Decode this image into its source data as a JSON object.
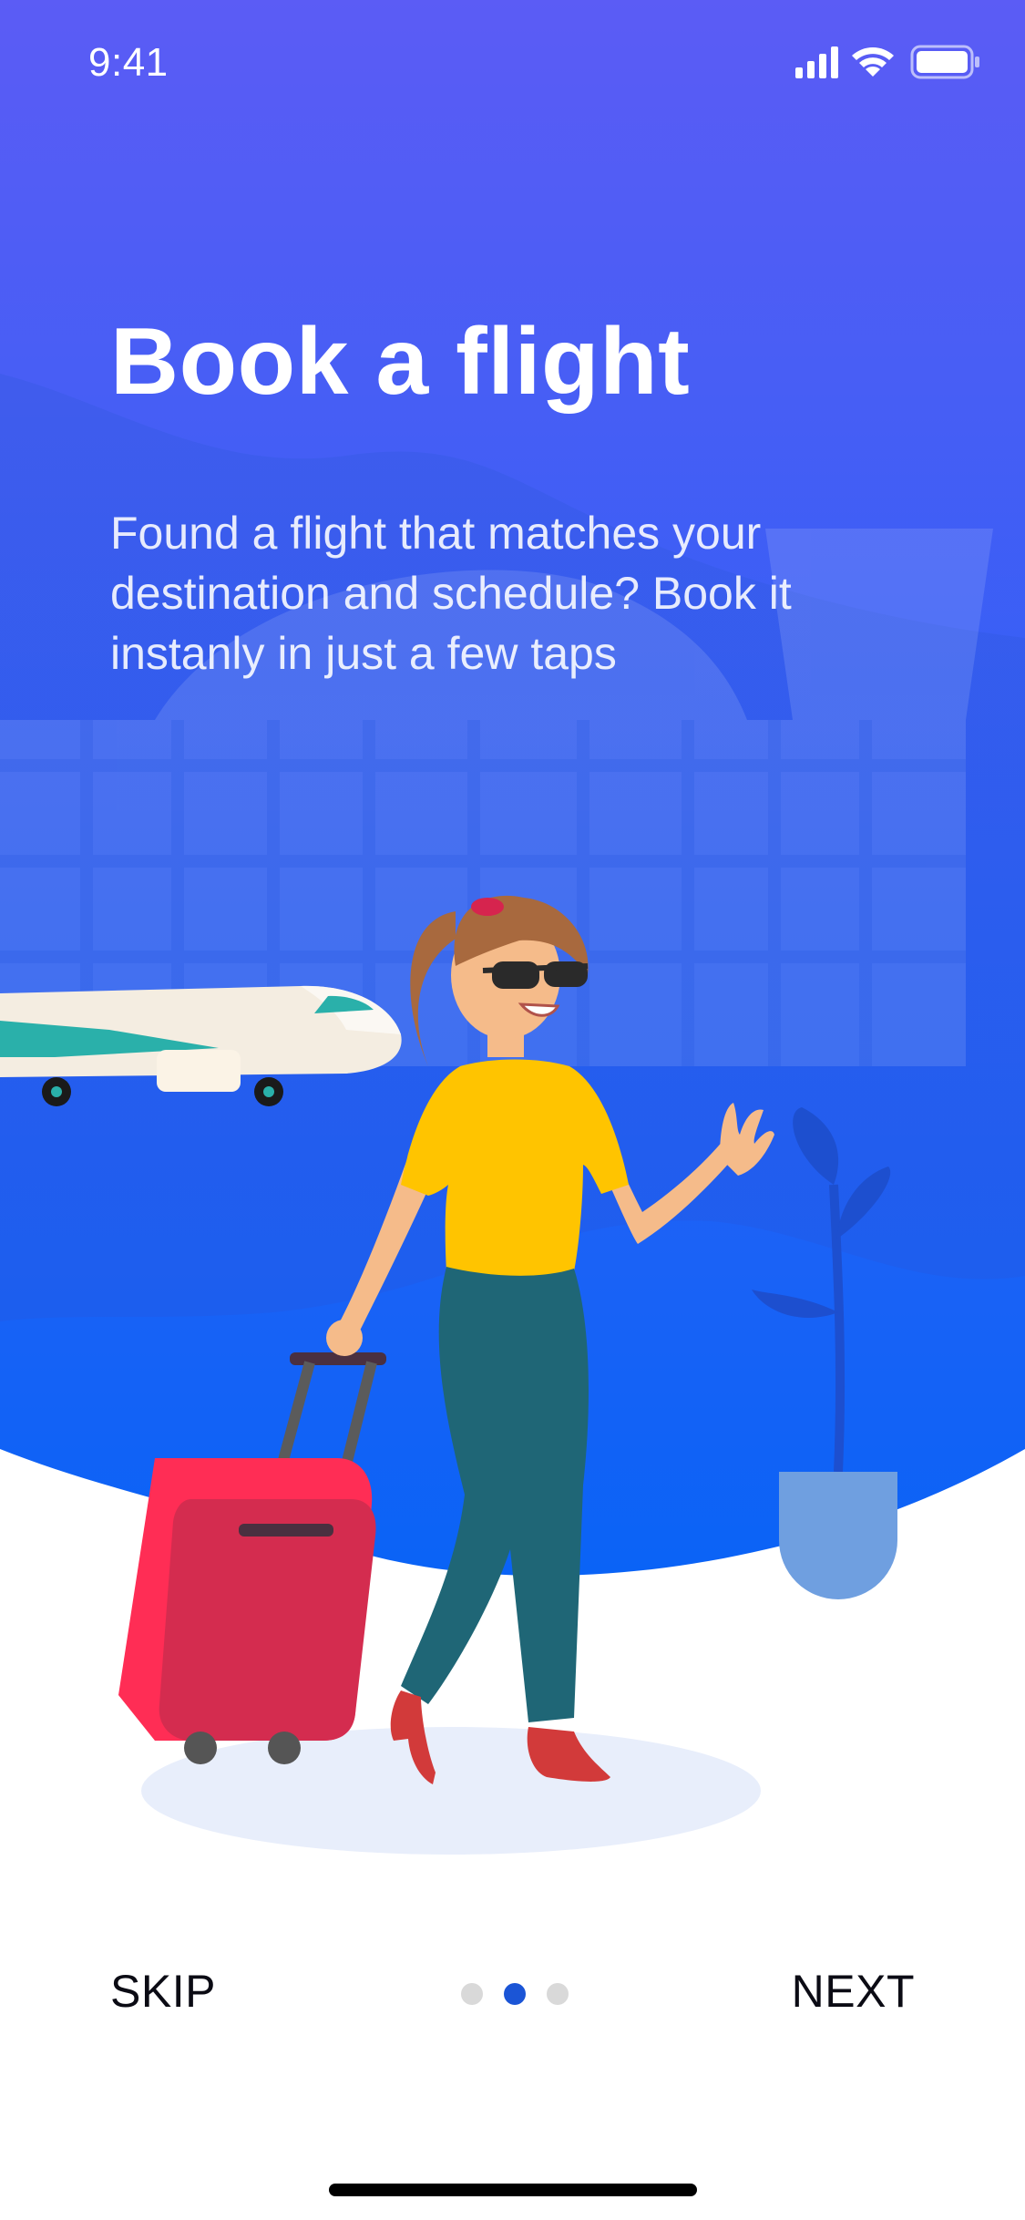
{
  "status_bar": {
    "time": "9:41",
    "icons": [
      "cellular-signal-icon",
      "wifi-icon",
      "battery-icon"
    ]
  },
  "onboarding": {
    "title": "Book a flight",
    "description": "Found a flight that matches your destination and schedule? Book it instanly in just a few taps",
    "page_indicator": {
      "total": 3,
      "current": 2
    }
  },
  "navigation": {
    "skip_label": "SKIP",
    "next_label": "NEXT"
  },
  "colors": {
    "gradient_top": "#5b5cf5",
    "gradient_bottom": "#0a63f6",
    "active_dot": "#1b55d6",
    "inactive_dot": "#d9d9d9",
    "text_dark": "#0b0b14"
  },
  "illustration": {
    "elements": [
      "airport-terminal",
      "airplane",
      "traveler-woman",
      "suitcase",
      "potted-plant"
    ]
  }
}
